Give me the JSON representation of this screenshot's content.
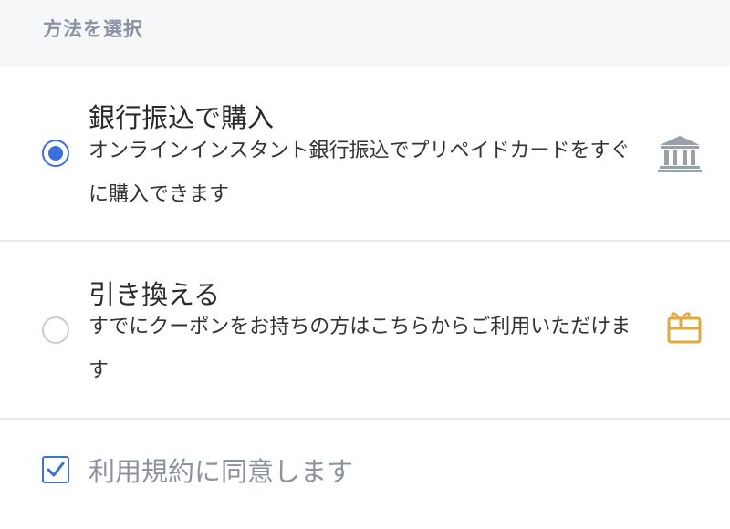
{
  "header": {
    "title": "方法を選択"
  },
  "options": [
    {
      "title": "銀行振込で購入",
      "description": "オンラインインスタント銀行振込でプリペイドカードをすぐに購入できます",
      "selected": true,
      "icon": "bank-icon",
      "icon_color": "#9aa0a8"
    },
    {
      "title": "引き換える",
      "description": "すでにクーポンをお持ちの方はこちらからご利用いただけます",
      "selected": false,
      "icon": "gift-card-icon",
      "icon_color": "#e0a93b"
    }
  ],
  "terms": {
    "label": "利用規約に同意します",
    "checked": true
  },
  "colors": {
    "accent": "#3b6fe0",
    "muted_text": "#8c939e",
    "header_bg": "#f6f7f9"
  }
}
